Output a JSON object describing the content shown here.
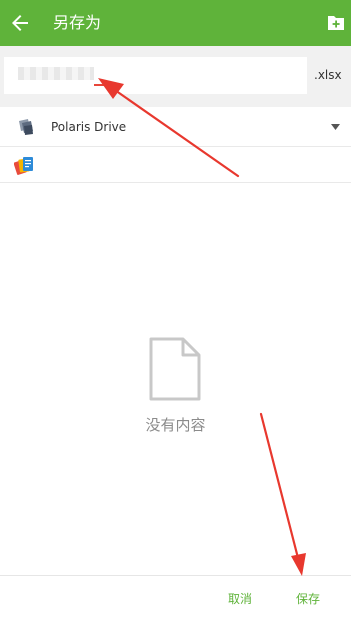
{
  "app_bar": {
    "title": "另存为",
    "back_icon": "arrow-left-icon",
    "action_icon": "new-folder-icon",
    "color": "#5fb33a"
  },
  "file_name": {
    "value": "",
    "extension": ".xlsx"
  },
  "storage": {
    "drive_label": "Polaris Drive",
    "drive_icon": "polaris-drive-icon",
    "dropdown_icon": "caret-down-icon",
    "folder_icon": "polaris-office-icon"
  },
  "empty_state": {
    "icon": "blank-document-icon",
    "text": "没有内容"
  },
  "footer": {
    "cancel_label": "取消",
    "save_label": "保存"
  },
  "annotation_color": "#e8382e"
}
